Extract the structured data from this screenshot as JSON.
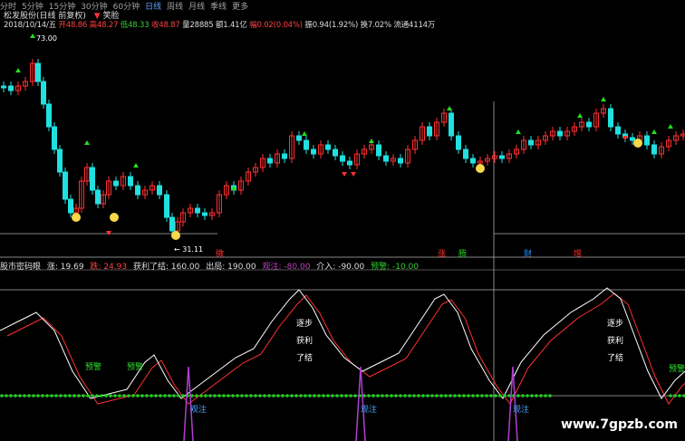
{
  "period_tabs": [
    "分时",
    "5分钟",
    "15分钟",
    "30分钟",
    "60分钟",
    "日线",
    "周线",
    "月线",
    "季线",
    "更多"
  ],
  "active_tab": "日线",
  "chart_title": "松发股份(日线 前复权)",
  "title_tag": "笑脸",
  "quote": {
    "date": "2018/10/14/五",
    "open": "开48.86",
    "high": "高48.27",
    "low": "低48.33",
    "close": "收48.87",
    "volume": "量28885",
    "amount": "额1.41亿",
    "change": "幅0.02(0.04%)",
    "amplitude": "振0.94(1.92%)",
    "turnover": "换7.02%",
    "float": "流通4114万"
  },
  "price_labels": {
    "high": "73.00",
    "low": "31.11"
  },
  "signal_labels": [
    "微",
    "涨",
    "腾",
    "财",
    "增"
  ],
  "indicator": {
    "name": "股市密码眼",
    "v1_label": "涨: 19.69",
    "v2_label": "跌: 24.93",
    "v3_label": "获利了结: 160.00",
    "v4_label": "出局: 190.00",
    "v5_label": "观注: -80.00",
    "v6_label": "介入: -90.00",
    "v7_label": "预警: -10.00"
  },
  "annotations": {
    "warn": "预警",
    "watch": "观注",
    "profit": [
      "逐步",
      "获利",
      "了结"
    ]
  },
  "colors": {
    "up": "#ff3030",
    "down": "#20e0e0",
    "ma": "#ffffff",
    "ma2": "#ff3030",
    "dots": "#20d020",
    "spike": "#b040d0"
  },
  "watermark": "www.7gpzb.com"
}
